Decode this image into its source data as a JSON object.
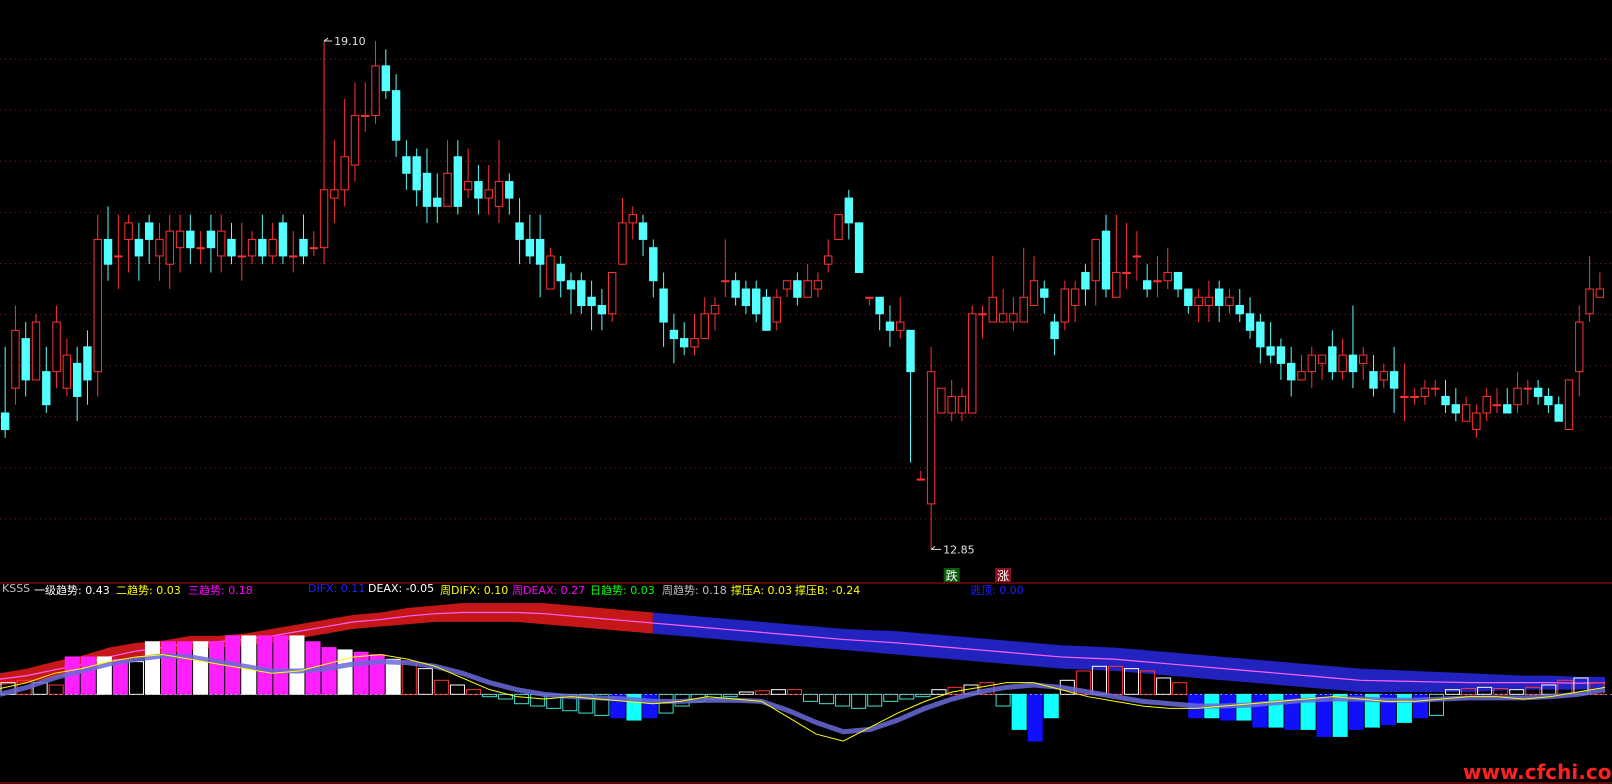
{
  "chart_data": [
    {
      "type": "candlestick",
      "title": "",
      "ylim": [
        12.6,
        19.4
      ],
      "max_label": "19.10",
      "min_label": "12.85",
      "signal_labels": {
        "fall": "跌",
        "rise": "涨"
      },
      "candles": [
        [
          14.5,
          14.3,
          15.3,
          14.2
        ],
        [
          14.8,
          15.5,
          15.8,
          14.6
        ],
        [
          15.4,
          14.9,
          15.6,
          14.7
        ],
        [
          14.9,
          15.6,
          15.7,
          14.9
        ],
        [
          15.0,
          14.6,
          15.3,
          14.5
        ],
        [
          15.0,
          15.6,
          15.8,
          14.8
        ],
        [
          14.8,
          15.2,
          15.4,
          14.7
        ],
        [
          15.1,
          14.7,
          15.3,
          14.4
        ],
        [
          15.3,
          14.9,
          15.5,
          14.6
        ],
        [
          15.0,
          16.6,
          16.9,
          14.7
        ],
        [
          16.6,
          16.3,
          17.0,
          16.1
        ],
        [
          16.4,
          16.4,
          16.9,
          16.0
        ],
        [
          16.6,
          16.8,
          16.9,
          16.2
        ],
        [
          16.6,
          16.4,
          16.8,
          16.1
        ],
        [
          16.8,
          16.6,
          16.9,
          16.3
        ],
        [
          16.4,
          16.6,
          16.8,
          16.1
        ],
        [
          16.3,
          16.7,
          16.9,
          16.0
        ],
        [
          16.5,
          16.7,
          16.9,
          16.2
        ],
        [
          16.7,
          16.5,
          16.9,
          16.3
        ],
        [
          16.5,
          16.5,
          16.7,
          16.3
        ],
        [
          16.7,
          16.5,
          16.9,
          16.2
        ],
        [
          16.4,
          16.7,
          16.9,
          16.2
        ],
        [
          16.6,
          16.4,
          16.8,
          16.3
        ],
        [
          16.4,
          16.4,
          16.8,
          16.1
        ],
        [
          16.4,
          16.6,
          16.7,
          16.3
        ],
        [
          16.6,
          16.4,
          16.9,
          16.3
        ],
        [
          16.4,
          16.6,
          16.8,
          16.3
        ],
        [
          16.8,
          16.4,
          16.9,
          16.3
        ],
        [
          16.4,
          16.4,
          16.7,
          16.2
        ],
        [
          16.6,
          16.4,
          16.9,
          16.3
        ],
        [
          16.5,
          16.5,
          16.7,
          16.4
        ],
        [
          16.5,
          17.2,
          19.0,
          16.3
        ],
        [
          17.1,
          17.2,
          17.8,
          16.8
        ],
        [
          17.2,
          17.6,
          18.3,
          17.0
        ],
        [
          17.5,
          18.1,
          18.5,
          17.3
        ],
        [
          18.1,
          18.1,
          18.5,
          17.9
        ],
        [
          18.1,
          18.7,
          19.0,
          18.0
        ],
        [
          18.7,
          18.4,
          18.9,
          18.3
        ],
        [
          18.4,
          17.8,
          18.6,
          17.6
        ],
        [
          17.6,
          17.4,
          17.8,
          17.2
        ],
        [
          17.6,
          17.2,
          17.7,
          17.0
        ],
        [
          17.4,
          17.0,
          17.7,
          16.8
        ],
        [
          17.1,
          17.0,
          17.4,
          16.8
        ],
        [
          17.0,
          17.4,
          17.8,
          17.0
        ],
        [
          17.6,
          17.0,
          17.8,
          16.9
        ],
        [
          17.2,
          17.3,
          17.7,
          17.1
        ],
        [
          17.3,
          17.1,
          17.5,
          16.9
        ],
        [
          17.1,
          17.2,
          17.5,
          16.9
        ],
        [
          17.0,
          17.3,
          17.8,
          16.8
        ],
        [
          17.3,
          17.1,
          17.4,
          16.9
        ],
        [
          16.8,
          16.6,
          17.1,
          16.3
        ],
        [
          16.6,
          16.4,
          16.9,
          16.3
        ],
        [
          16.6,
          16.3,
          16.9,
          15.9
        ],
        [
          16.0,
          16.4,
          16.5,
          16.0
        ],
        [
          16.3,
          16.1,
          16.4,
          15.9
        ],
        [
          16.1,
          16.0,
          16.2,
          15.7
        ],
        [
          16.1,
          15.8,
          16.2,
          15.7
        ],
        [
          15.9,
          15.8,
          16.1,
          15.5
        ],
        [
          15.8,
          15.7,
          16.0,
          15.5
        ],
        [
          15.7,
          16.2,
          16.2,
          15.6
        ],
        [
          16.3,
          16.8,
          17.1,
          16.3
        ],
        [
          16.8,
          16.9,
          17.0,
          16.6
        ],
        [
          16.8,
          16.6,
          16.9,
          16.4
        ],
        [
          16.5,
          16.1,
          16.6,
          15.9
        ],
        [
          16.0,
          15.6,
          16.2,
          15.3
        ],
        [
          15.5,
          15.4,
          15.7,
          15.1
        ],
        [
          15.4,
          15.3,
          15.6,
          15.2
        ],
        [
          15.3,
          15.4,
          15.7,
          15.2
        ],
        [
          15.4,
          15.7,
          15.9,
          15.4
        ],
        [
          15.7,
          15.8,
          15.9,
          15.5
        ],
        [
          16.1,
          16.1,
          16.6,
          15.9
        ],
        [
          16.1,
          15.9,
          16.2,
          15.8
        ],
        [
          16.0,
          15.8,
          16.1,
          15.7
        ],
        [
          16.0,
          15.7,
          16.1,
          15.6
        ],
        [
          15.9,
          15.5,
          16.0,
          15.5
        ],
        [
          15.6,
          15.9,
          16.0,
          15.5
        ],
        [
          16.0,
          16.1,
          16.1,
          15.9
        ],
        [
          16.1,
          15.9,
          16.2,
          15.8
        ],
        [
          15.9,
          16.1,
          16.3,
          15.9
        ],
        [
          16.0,
          16.1,
          16.2,
          15.9
        ],
        [
          16.3,
          16.4,
          16.6,
          16.2
        ],
        [
          16.6,
          16.9,
          16.9,
          16.6
        ],
        [
          17.1,
          16.8,
          17.2,
          16.6
        ],
        [
          16.8,
          16.2,
          16.8,
          16.2
        ],
        [
          15.9,
          15.9,
          15.9,
          15.8
        ],
        [
          15.9,
          15.7,
          15.9,
          15.5
        ],
        [
          15.6,
          15.5,
          15.8,
          15.3
        ],
        [
          15.5,
          15.6,
          15.9,
          15.4
        ],
        [
          15.5,
          15.0,
          15.5,
          13.9
        ],
        [
          13.7,
          13.7,
          13.8,
          13.7
        ],
        [
          13.4,
          15.0,
          15.3,
          12.85
        ],
        [
          14.5,
          14.8,
          14.8,
          14.5
        ],
        [
          14.5,
          14.7,
          14.9,
          14.4
        ],
        [
          14.5,
          14.7,
          14.8,
          14.4
        ],
        [
          14.5,
          15.7,
          15.8,
          14.5
        ],
        [
          15.7,
          15.7,
          15.8,
          15.4
        ],
        [
          15.6,
          15.9,
          16.4,
          15.6
        ],
        [
          15.6,
          15.7,
          16.0,
          15.6
        ],
        [
          15.6,
          15.7,
          15.9,
          15.5
        ],
        [
          15.6,
          15.9,
          16.5,
          15.6
        ],
        [
          15.8,
          16.1,
          16.4,
          15.8
        ],
        [
          16.0,
          15.9,
          16.1,
          15.7
        ],
        [
          15.6,
          15.4,
          15.7,
          15.2
        ],
        [
          15.6,
          16.0,
          16.1,
          15.5
        ],
        [
          15.8,
          16.0,
          16.1,
          15.6
        ],
        [
          16.2,
          16.0,
          16.3,
          15.8
        ],
        [
          16.1,
          16.6,
          16.6,
          15.8
        ],
        [
          16.7,
          16.0,
          16.9,
          15.9
        ],
        [
          15.9,
          16.2,
          16.9,
          15.9
        ],
        [
          16.2,
          16.2,
          16.8,
          16.0
        ],
        [
          16.4,
          16.4,
          16.7,
          16.1
        ],
        [
          16.1,
          16.0,
          16.3,
          15.9
        ],
        [
          16.1,
          16.1,
          16.4,
          15.9
        ],
        [
          16.1,
          16.2,
          16.5,
          16.0
        ],
        [
          16.2,
          16.0,
          16.2,
          15.9
        ],
        [
          16.0,
          15.8,
          16.0,
          15.7
        ],
        [
          15.8,
          15.9,
          16.0,
          15.6
        ],
        [
          15.8,
          15.9,
          16.1,
          15.6
        ],
        [
          16.0,
          15.8,
          16.1,
          15.6
        ],
        [
          15.8,
          15.9,
          16.0,
          15.7
        ],
        [
          15.8,
          15.7,
          16.0,
          15.6
        ],
        [
          15.7,
          15.5,
          15.9,
          15.4
        ],
        [
          15.6,
          15.3,
          15.7,
          15.1
        ],
        [
          15.3,
          15.2,
          15.6,
          15.1
        ],
        [
          15.3,
          15.1,
          15.4,
          14.9
        ],
        [
          15.1,
          14.9,
          15.3,
          14.7
        ],
        [
          14.9,
          15.0,
          15.2,
          14.9
        ],
        [
          15.0,
          15.2,
          15.3,
          14.8
        ],
        [
          15.1,
          15.2,
          15.2,
          14.9
        ],
        [
          15.3,
          15.0,
          15.5,
          14.9
        ],
        [
          15.0,
          15.2,
          15.4,
          14.9
        ],
        [
          15.2,
          15.0,
          15.8,
          14.8
        ],
        [
          15.1,
          15.2,
          15.3,
          14.9
        ],
        [
          15.0,
          14.8,
          15.2,
          14.7
        ],
        [
          14.9,
          15.0,
          15.1,
          14.8
        ],
        [
          15.0,
          14.8,
          15.3,
          14.5
        ],
        [
          14.7,
          14.7,
          15.1,
          14.4
        ],
        [
          14.7,
          14.7,
          14.8,
          14.6
        ],
        [
          14.7,
          14.8,
          14.9,
          14.6
        ],
        [
          14.8,
          14.8,
          14.9,
          14.7
        ],
        [
          14.7,
          14.6,
          14.9,
          14.5
        ],
        [
          14.6,
          14.5,
          14.8,
          14.4
        ],
        [
          14.4,
          14.6,
          14.7,
          14.4
        ],
        [
          14.3,
          14.5,
          14.6,
          14.2
        ],
        [
          14.5,
          14.7,
          14.8,
          14.4
        ],
        [
          14.6,
          14.6,
          14.8,
          14.5
        ],
        [
          14.6,
          14.5,
          14.8,
          14.5
        ],
        [
          14.6,
          14.8,
          15.0,
          14.5
        ],
        [
          14.8,
          14.8,
          14.9,
          14.6
        ],
        [
          14.8,
          14.7,
          14.9,
          14.6
        ],
        [
          14.7,
          14.6,
          14.8,
          14.5
        ],
        [
          14.6,
          14.4,
          14.7,
          14.4
        ],
        [
          14.3,
          14.9,
          14.9,
          14.3
        ],
        [
          15.0,
          15.6,
          15.8,
          14.7
        ],
        [
          15.7,
          16.0,
          16.4,
          15.6
        ],
        [
          15.9,
          16.0,
          16.2,
          15.9
        ]
      ]
    },
    {
      "type": "indicator",
      "panel_name": "KSSS",
      "readouts": [
        {
          "label": "一级趋势",
          "value": "0.43",
          "color": "#ffffff"
        },
        {
          "label": "二趋势",
          "value": "0.03",
          "color": "#ffff00"
        },
        {
          "label": "三趋势",
          "value": "0.18",
          "color": "#ff00ff"
        },
        {
          "label": "DIFX",
          "value": "0.11",
          "color": "#2020ff"
        },
        {
          "label": "DEAX",
          "value": "-0.05",
          "color": "#ffffff"
        },
        {
          "label": "周DIFX",
          "value": "0.10",
          "color": "#ffff00"
        },
        {
          "label": "周DEAX",
          "value": "0.27",
          "color": "#ff00ff"
        },
        {
          "label": "日趋势",
          "value": "0.03",
          "color": "#00ff00"
        },
        {
          "label": "周趋势",
          "value": "0.18",
          "color": "#c0c0c0"
        },
        {
          "label": "撑压A",
          "value": "0.03",
          "color": "#ffff00"
        },
        {
          "label": "撑压B",
          "value": "-0.24",
          "color": "#ffff00"
        },
        {
          "label": "逃顶",
          "value": "0.00",
          "color": "#2020ff"
        }
      ],
      "ylim": [
        -0.75,
        0.85
      ],
      "band_upper": [
        0.18,
        0.22,
        0.28,
        0.33,
        0.4,
        0.44,
        0.46,
        0.5,
        0.5,
        0.52,
        0.56,
        0.6,
        0.64,
        0.68,
        0.7,
        0.74,
        0.76,
        0.78,
        0.78,
        0.78,
        0.78,
        0.76,
        0.74,
        0.72,
        0.7,
        0.68,
        0.66,
        0.64,
        0.62,
        0.6,
        0.58,
        0.56,
        0.55,
        0.54,
        0.52,
        0.5,
        0.48,
        0.46,
        0.44,
        0.42,
        0.41,
        0.4,
        0.38,
        0.36,
        0.34,
        0.32,
        0.3,
        0.28,
        0.26,
        0.24,
        0.22,
        0.21,
        0.2,
        0.19,
        0.18,
        0.17,
        0.16,
        0.16,
        0.15,
        0.15
      ],
      "band_lower": [
        0.08,
        0.1,
        0.14,
        0.18,
        0.24,
        0.3,
        0.34,
        0.38,
        0.4,
        0.42,
        0.44,
        0.48,
        0.52,
        0.56,
        0.58,
        0.6,
        0.62,
        0.62,
        0.62,
        0.62,
        0.6,
        0.58,
        0.56,
        0.54,
        0.52,
        0.5,
        0.48,
        0.46,
        0.44,
        0.42,
        0.4,
        0.38,
        0.36,
        0.34,
        0.32,
        0.3,
        0.28,
        0.26,
        0.24,
        0.22,
        0.21,
        0.2,
        0.18,
        0.16,
        0.14,
        0.12,
        0.1,
        0.08,
        0.06,
        0.04,
        0.02,
        0.02,
        0.02,
        0.02,
        0.02,
        0.03,
        0.04,
        0.04,
        0.04,
        0.05
      ],
      "histogram": [
        0.1,
        0.12,
        0.1,
        0.08,
        0.32,
        0.32,
        0.32,
        0.3,
        0.28,
        0.45,
        0.45,
        0.45,
        0.45,
        0.45,
        0.5,
        0.5,
        0.5,
        0.5,
        0.5,
        0.45,
        0.4,
        0.38,
        0.36,
        0.34,
        0.3,
        0.28,
        0.22,
        0.12,
        0.08,
        0.04,
        -0.02,
        -0.04,
        -0.08,
        -0.1,
        -0.12,
        -0.14,
        -0.16,
        -0.18,
        -0.2,
        -0.22,
        -0.2,
        -0.16,
        -0.1,
        -0.06,
        -0.04,
        -0.02,
        0.02,
        0.03,
        0.04,
        0.04,
        -0.06,
        -0.08,
        -0.1,
        -0.12,
        -0.1,
        -0.06,
        -0.04,
        -0.02,
        0.04,
        0.06,
        0.08,
        0.1,
        -0.1,
        -0.3,
        -0.4,
        -0.2,
        0.12,
        0.2,
        0.24,
        0.24,
        0.22,
        0.2,
        0.14,
        0.1,
        -0.2,
        -0.2,
        -0.22,
        -0.22,
        -0.28,
        -0.28,
        -0.3,
        -0.3,
        -0.36,
        -0.36,
        -0.3,
        -0.28,
        -0.26,
        -0.24,
        -0.2,
        -0.18,
        0.04,
        0.05,
        0.06,
        0.05,
        0.04,
        0.06,
        0.08,
        0.12,
        0.14,
        0.1
      ],
      "fast_line": [
        0.05,
        0.1,
        0.18,
        0.22,
        0.28,
        0.32,
        0.34,
        0.3,
        0.26,
        0.22,
        0.18,
        0.2,
        0.26,
        0.32,
        0.34,
        0.3,
        0.24,
        0.14,
        0.04,
        -0.02,
        -0.04,
        -0.02,
        -0.04,
        -0.06,
        -0.08,
        -0.06,
        -0.02,
        -0.04,
        -0.06,
        -0.2,
        -0.34,
        -0.4,
        -0.28,
        -0.16,
        -0.06,
        0.02,
        0.06,
        0.1,
        0.1,
        0.04,
        -0.02,
        -0.06,
        -0.1,
        -0.12,
        -0.12,
        -0.1,
        -0.08,
        -0.06,
        -0.04,
        -0.02,
        -0.04,
        -0.06,
        -0.06,
        -0.04,
        -0.02,
        -0.02,
        -0.04,
        -0.02,
        0.02,
        0.06
      ],
      "slow_line": [
        0.0,
        0.06,
        0.14,
        0.2,
        0.26,
        0.3,
        0.33,
        0.32,
        0.28,
        0.24,
        0.2,
        0.2,
        0.22,
        0.26,
        0.28,
        0.27,
        0.24,
        0.18,
        0.1,
        0.04,
        0.0,
        -0.02,
        -0.03,
        -0.04,
        -0.06,
        -0.06,
        -0.05,
        -0.05,
        -0.06,
        -0.14,
        -0.24,
        -0.32,
        -0.3,
        -0.22,
        -0.12,
        -0.04,
        0.02,
        0.06,
        0.08,
        0.06,
        0.02,
        -0.02,
        -0.06,
        -0.08,
        -0.1,
        -0.1,
        -0.09,
        -0.07,
        -0.05,
        -0.04,
        -0.04,
        -0.05,
        -0.05,
        -0.04,
        -0.03,
        -0.03,
        -0.03,
        -0.02,
        0.0,
        0.04
      ]
    }
  ],
  "watermark": "www.cfchi.com"
}
